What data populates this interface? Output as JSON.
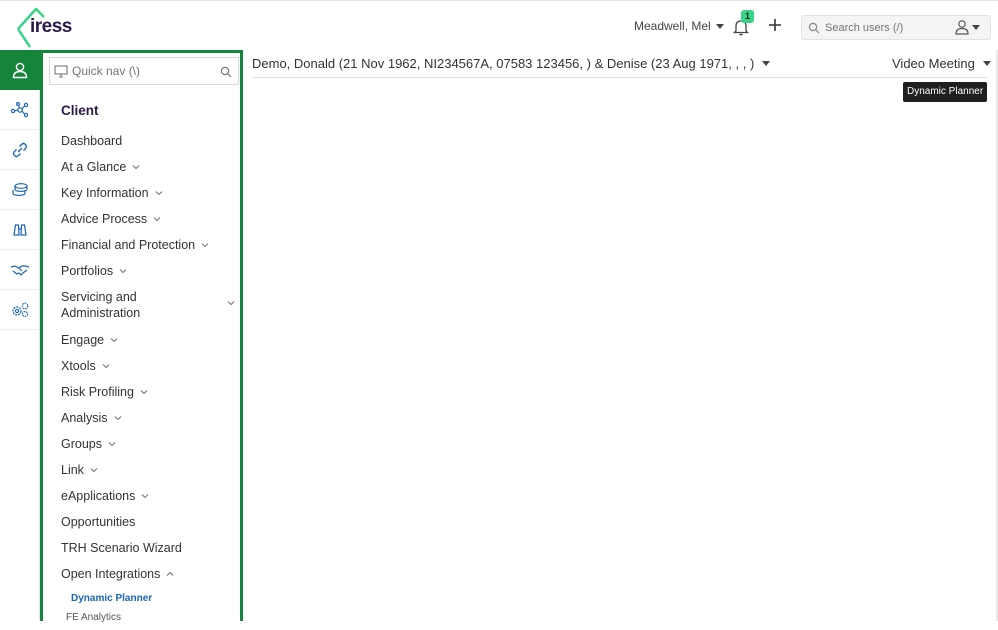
{
  "logo": {
    "text": "iress",
    "brand_color": "#3bd38a"
  },
  "header": {
    "user_name": "Meadwell, Mel",
    "notification_count": "1",
    "search_placeholder": "Search users (/)"
  },
  "rail": {
    "items": [
      {
        "icon": "person-icon",
        "active": true
      },
      {
        "icon": "network-icon",
        "active": false
      },
      {
        "icon": "link-icon",
        "active": false
      },
      {
        "icon": "coins-icon",
        "active": false
      },
      {
        "icon": "binoculars-icon",
        "active": false
      },
      {
        "icon": "handshake-icon",
        "active": false
      },
      {
        "icon": "gears-icon",
        "active": false
      }
    ],
    "accent_color": "#14853b"
  },
  "nav": {
    "quicknav_placeholder": "Quick nav (\\)",
    "heading": "Client",
    "items": [
      {
        "label": "Dashboard",
        "expandable": false
      },
      {
        "label": "At a Glance",
        "expandable": true
      },
      {
        "label": "Key Information",
        "expandable": true
      },
      {
        "label": "Advice Process",
        "expandable": true
      },
      {
        "label": "Financial and Protection",
        "expandable": true
      },
      {
        "label": "Portfolios",
        "expandable": true
      },
      {
        "label": "Servicing and Administration",
        "expandable": true
      },
      {
        "label": "Engage",
        "expandable": true
      },
      {
        "label": "Xtools",
        "expandable": true
      },
      {
        "label": "Risk Profiling",
        "expandable": true
      },
      {
        "label": "Analysis",
        "expandable": true
      },
      {
        "label": "Groups",
        "expandable": true
      },
      {
        "label": "Link",
        "expandable": true
      },
      {
        "label": "eApplications",
        "expandable": true
      },
      {
        "label": "Opportunities",
        "expandable": false
      },
      {
        "label": "TRH Scenario Wizard",
        "expandable": false
      },
      {
        "label": "Open Integrations",
        "expandable": true,
        "expanded": true
      }
    ],
    "sub_items": [
      {
        "label": "Dynamic Planner",
        "active": true
      },
      {
        "label": "FE Analytics",
        "active": false
      }
    ]
  },
  "main": {
    "client_title": "Demo, Donald (21 Nov 1962, NI234567A, 07583 123456, ) & Denise (23 Aug 1971, , , )",
    "meeting_label": "Video Meeting",
    "tooltip": "Dynamic Planner"
  }
}
